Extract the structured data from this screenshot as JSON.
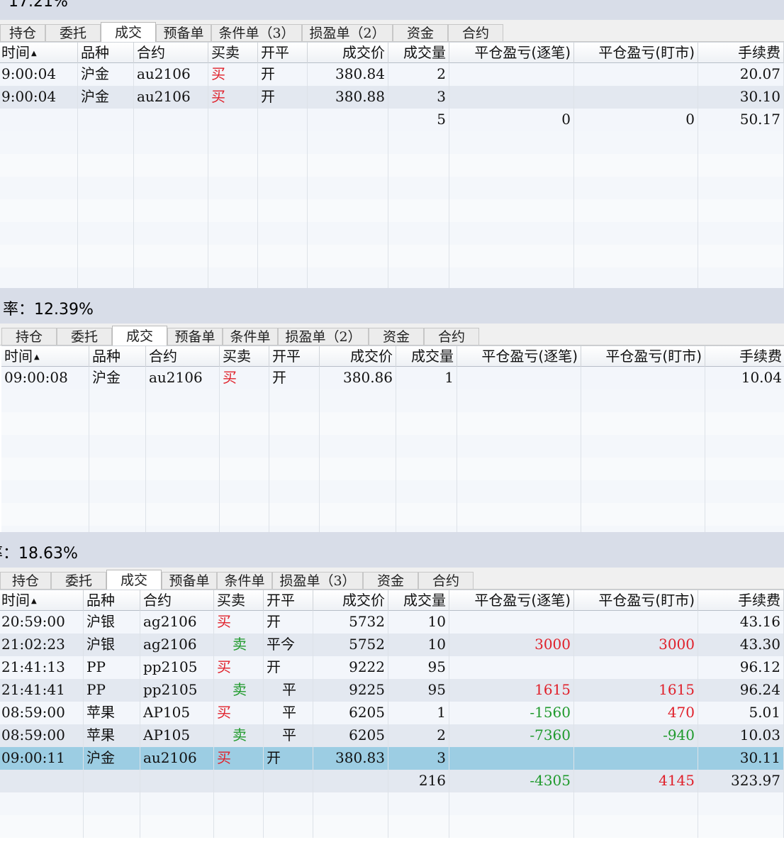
{
  "panels": [
    {
      "rate_text": "17.21%",
      "tabs": [
        "持仓",
        "委托",
        "成交",
        "预备单",
        "条件单（3）",
        "损盈单（2）",
        "资金",
        "合约"
      ],
      "active_tab": 2,
      "columns": [
        "时间",
        "品种",
        "合约",
        "买卖",
        "开平",
        "成交价",
        "成交量",
        "平仓盈亏(逐笔)",
        "平仓盈亏(盯市)",
        "手续费"
      ],
      "rows": [
        {
          "time": "9:00:04",
          "variety": "沪金",
          "contract": "au2106",
          "side": "买",
          "open_close": "开",
          "price": "380.84",
          "qty": "2",
          "pnl_trade": "",
          "pnl_mark": "",
          "fee": "20.07"
        },
        {
          "time": "9:00:04",
          "variety": "沪金",
          "contract": "au2106",
          "side": "买",
          "open_close": "开",
          "price": "380.88",
          "qty": "3",
          "pnl_trade": "",
          "pnl_mark": "",
          "fee": "30.10"
        },
        {
          "time": "",
          "variety": "",
          "contract": "",
          "side": "",
          "open_close": "",
          "price": "",
          "qty": "5",
          "pnl_trade": "0",
          "pnl_mark": "0",
          "fee": "50.17"
        }
      ]
    },
    {
      "rate_text": "率：12.39%",
      "tabs": [
        "持仓",
        "委托",
        "成交",
        "预备单",
        "条件单",
        "损盈单（2）",
        "资金",
        "合约"
      ],
      "active_tab": 2,
      "columns": [
        "时间",
        "品种",
        "合约",
        "买卖",
        "开平",
        "成交价",
        "成交量",
        "平仓盈亏(逐笔)",
        "平仓盈亏(盯市)",
        "手续费"
      ],
      "rows": [
        {
          "time": "09:00:08",
          "variety": "沪金",
          "contract": "au2106",
          "side": "买",
          "open_close": "开",
          "price": "380.86",
          "qty": "1",
          "pnl_trade": "",
          "pnl_mark": "",
          "fee": "10.04"
        }
      ]
    },
    {
      "rate_text": "率：18.63%",
      "tabs": [
        "持仓",
        "委托",
        "成交",
        "预备单",
        "条件单",
        "损盈单（3）",
        "资金",
        "合约"
      ],
      "active_tab": 2,
      "columns": [
        "时间",
        "品种",
        "合约",
        "买卖",
        "开平",
        "成交价",
        "成交量",
        "平仓盈亏(逐笔)",
        "平仓盈亏(盯市)",
        "手续费"
      ],
      "rows": [
        {
          "time": "20:59:00",
          "variety": "沪银",
          "contract": "ag2106",
          "side": "买",
          "open_close": "开",
          "price": "5732",
          "qty": "10",
          "pnl_trade": "",
          "pnl_mark": "",
          "fee": "43.16"
        },
        {
          "time": "21:02:23",
          "variety": "沪银",
          "contract": "ag2106",
          "side": "卖",
          "open_close": "平今",
          "price": "5752",
          "qty": "10",
          "pnl_trade": "3000",
          "pnl_mark": "3000",
          "fee": "43.30"
        },
        {
          "time": "21:41:13",
          "variety": "PP",
          "contract": "pp2105",
          "side": "买",
          "open_close": "开",
          "price": "9222",
          "qty": "95",
          "pnl_trade": "",
          "pnl_mark": "",
          "fee": "96.12"
        },
        {
          "time": "21:41:41",
          "variety": "PP",
          "contract": "pp2105",
          "side": "卖",
          "open_close": "平",
          "price": "9225",
          "qty": "95",
          "pnl_trade": "1615",
          "pnl_mark": "1615",
          "fee": "96.24"
        },
        {
          "time": "08:59:00",
          "variety": "苹果",
          "contract": "AP105",
          "side": "买",
          "open_close": "平",
          "price": "6205",
          "qty": "1",
          "pnl_trade": "-1560",
          "pnl_mark": "470",
          "fee": "5.01"
        },
        {
          "time": "08:59:00",
          "variety": "苹果",
          "contract": "AP105",
          "side": "卖",
          "open_close": "平",
          "price": "6205",
          "qty": "2",
          "pnl_trade": "-7360",
          "pnl_mark": "-940",
          "fee": "10.03"
        },
        {
          "time": "09:00:11",
          "variety": "沪金",
          "contract": "au2106",
          "side": "买",
          "open_close": "开",
          "price": "380.83",
          "qty": "3",
          "pnl_trade": "",
          "pnl_mark": "",
          "fee": "30.11",
          "selected": true
        },
        {
          "time": "",
          "variety": "",
          "contract": "",
          "side": "",
          "open_close": "",
          "price": "",
          "qty": "216",
          "pnl_trade": "-4305",
          "pnl_mark": "4145",
          "fee": "323.97"
        }
      ]
    }
  ],
  "colors": {
    "buy": "#e0202a",
    "sell": "#1f9a2c",
    "profit": "#e0202a",
    "loss": "#1f9a2c",
    "selected_row": "#9ccde3",
    "rate_bar": "#d8dde8"
  },
  "icons": {
    "sort_indicator": "sort-ascending-icon"
  }
}
